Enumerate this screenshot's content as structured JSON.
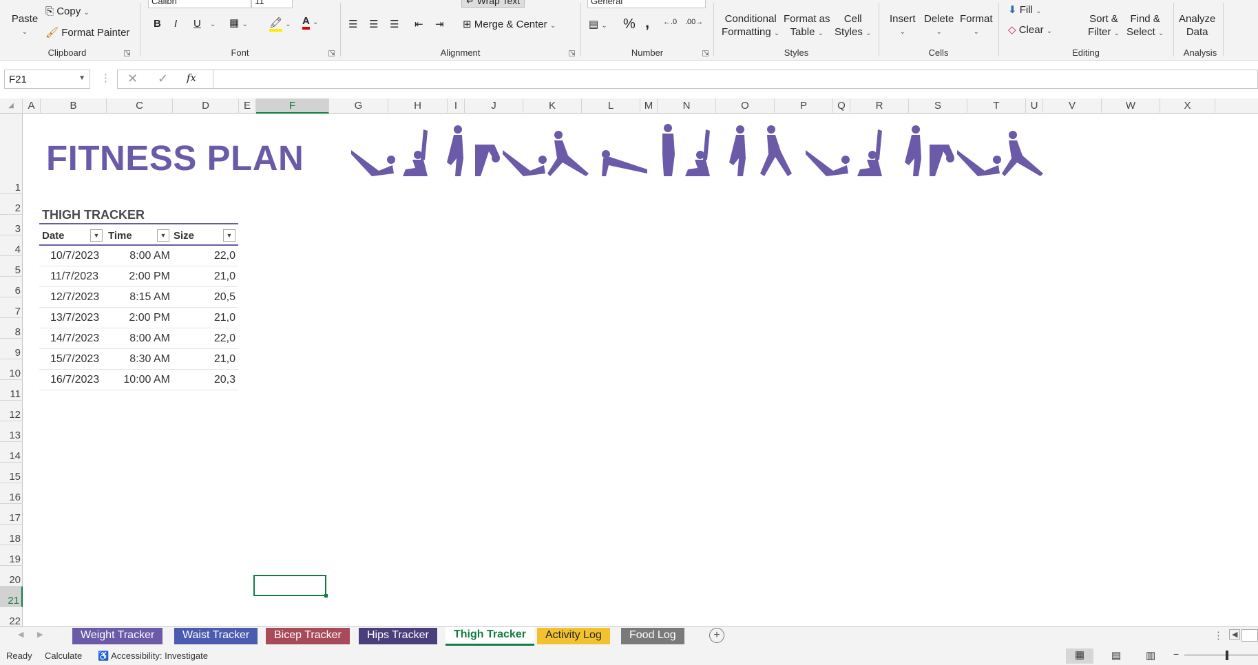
{
  "ribbon": {
    "clipboard": {
      "paste": "Paste",
      "copy": "Copy",
      "format_painter": "Format Painter",
      "label": "Clipboard"
    },
    "font": {
      "name": "Calibri",
      "size": "11",
      "bold": "B",
      "italic": "I",
      "underline": "U",
      "label": "Font"
    },
    "alignment": {
      "wrap_text": "Wrap Text",
      "merge_center": "Merge & Center",
      "label": "Alignment"
    },
    "number": {
      "format": "General",
      "percent": "%",
      "comma": ",",
      "label": "Number"
    },
    "styles": {
      "conditional_1": "Conditional",
      "conditional_2": "Formatting",
      "format_table_1": "Format as",
      "format_table_2": "Table",
      "cell_styles_1": "Cell",
      "cell_styles_2": "Styles",
      "label": "Styles"
    },
    "cells": {
      "insert": "Insert",
      "delete": "Delete",
      "format": "Format",
      "label": "Cells"
    },
    "editing": {
      "fill": "Fill",
      "clear": "Clear",
      "sort_1": "Sort &",
      "sort_2": "Filter",
      "find_1": "Find &",
      "find_2": "Select",
      "label": "Editing"
    },
    "analysis": {
      "analyze_1": "Analyze",
      "analyze_2": "Data",
      "label": "Analysis"
    }
  },
  "formula_bar": {
    "name_box": "F21",
    "fx": "fx",
    "value": ""
  },
  "columns": [
    "A",
    "B",
    "C",
    "D",
    "E",
    "F",
    "G",
    "H",
    "I",
    "J",
    "K",
    "L",
    "M",
    "N",
    "O",
    "P",
    "Q",
    "R",
    "S",
    "T",
    "U",
    "V",
    "W",
    "X"
  ],
  "rows": [
    "1",
    "2",
    "3",
    "4",
    "5",
    "6",
    "7",
    "8",
    "9",
    "10",
    "11",
    "12",
    "13",
    "14",
    "15",
    "16",
    "17",
    "18",
    "19",
    "20",
    "21",
    "22"
  ],
  "sheet": {
    "title": "FITNESS PLAN",
    "tracker_title": "THIGH TRACKER",
    "headers": [
      "Date",
      "Time",
      "Size"
    ],
    "data": [
      [
        "10/7/2023",
        "8:00 AM",
        "22,0"
      ],
      [
        "11/7/2023",
        "2:00 PM",
        "21,0"
      ],
      [
        "12/7/2023",
        "8:15 AM",
        "20,5"
      ],
      [
        "13/7/2023",
        "2:00 PM",
        "21,0"
      ],
      [
        "14/7/2023",
        "8:00 AM",
        "22,0"
      ],
      [
        "15/7/2023",
        "8:30 AM",
        "21,0"
      ],
      [
        "16/7/2023",
        "10:00 AM",
        "20,3"
      ]
    ],
    "accent_color": "#6a5aa8"
  },
  "tabs": [
    {
      "label": "Weight Tracker",
      "color": "#6a5aa8"
    },
    {
      "label": "Waist Tracker",
      "color": "#4a5bb0"
    },
    {
      "label": "Bicep Tracker",
      "color": "#a84a5a"
    },
    {
      "label": "Hips Tracker",
      "color": "#4a3f7a"
    },
    {
      "label": "Thigh Tracker",
      "color": "#ffffff"
    },
    {
      "label": "Activity Log",
      "color": "#f2c22e"
    },
    {
      "label": "Food Log",
      "color": "#7a7a7a"
    }
  ],
  "status": {
    "ready": "Ready",
    "calculate": "Calculate",
    "accessibility": "Accessibility: Investigate"
  }
}
